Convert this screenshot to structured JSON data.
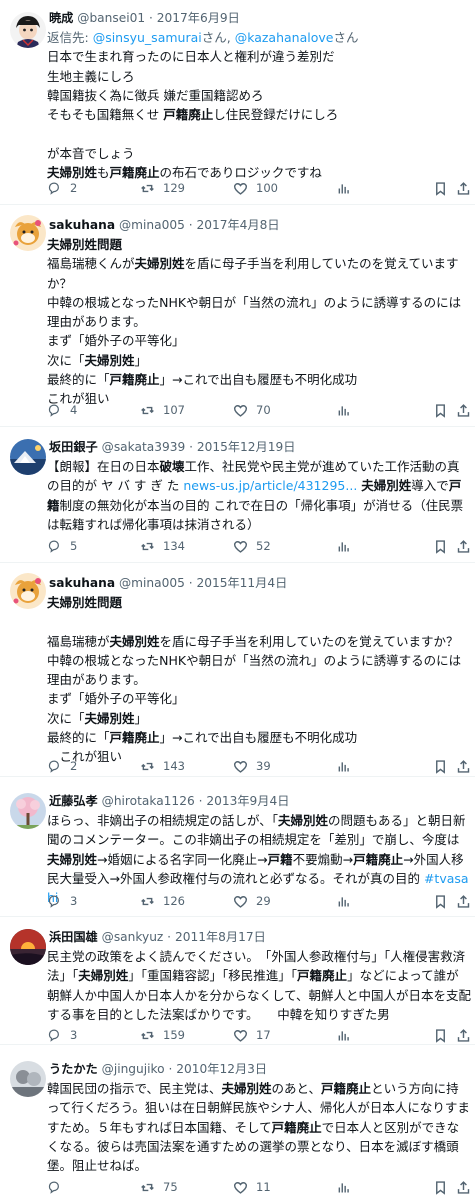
{
  "tweets": [
    {
      "name": "暁成",
      "handle": "@bansei01",
      "date": "2017年6月9日",
      "reply_prefix": "返信先: ",
      "reply_mention1": "@sinsyu_samurai",
      "reply_mid": "さん, ",
      "reply_mention2": "@kazahanalove",
      "reply_suffix": "さん",
      "lines": [
        "日本で生まれ育ったのに日本人と権利が違う差別だ",
        "生地主義にしろ",
        "韓国籍抜く為に徴兵 嫌だ重国籍認めろ",
        "そもそも国籍無くせ 戸籍廃止し住民登録だけにしろ",
        "",
        "が本音でしょう",
        "夫婦別姓も戸籍廃止の布石でありロジックですね"
      ],
      "counts": {
        "reply": "2",
        "retweet": "129",
        "like": "100"
      }
    },
    {
      "name": "sakuhana",
      "handle": "@mina005",
      "date": "2017年4月8日",
      "lines": [
        "夫婦別姓問題",
        "福島瑞穂くんが夫婦別姓を盾に母子手当を利用していたのを覚えていますか？",
        "中韓の根城となったNHKや朝日が「当然の流れ」のように誘導するのには理由があります。",
        "まず「婚外子の平等化」",
        "次に「夫婦別姓」",
        "最終的に「戸籍廃止」→これで出自も履歴も不明化成功",
        "これが狙い"
      ],
      "counts": {
        "reply": "4",
        "retweet": "107",
        "like": "70"
      }
    },
    {
      "name": "坂田銀子",
      "handle": "@sakata3939",
      "date": "2015年12月19日",
      "text": "【朗報】在日の日本破壊工作、社民党や民主党が進めていた工作活動の真の目的が ヤ バ す ぎ た news-us.jp/article/431295... 夫婦別姓導入で戸籍制度の無効化が本当の目的 これで在日の「帰化事項」が消せる（住民票は転籍すれば帰化事項は抹消される）",
      "link": "news-us.jp/article/431295...",
      "counts": {
        "reply": "5",
        "retweet": "134",
        "like": "52"
      }
    },
    {
      "name": "sakuhana",
      "handle": "@mina005",
      "date": "2015年11月4日",
      "lines": [
        "夫婦別姓問題",
        "",
        "福島瑞穂が夫婦別姓を盾に母子手当を利用していたのを覚えていますか？",
        "中韓の根城となったNHKや朝日が「当然の流れ」のように誘導するのには理由があります。",
        "まず「婚外子の平等化」",
        "次に「夫婦別姓」",
        "最終的に「戸籍廃止」→これで出自も履歴も不明化成功",
        "　これが狙い"
      ],
      "counts": {
        "reply": "2",
        "retweet": "143",
        "like": "39"
      }
    },
    {
      "name": "近藤弘孝",
      "handle": "@hirotaka1126",
      "date": "2013年9月4日",
      "text": "ほらっ、非嫡出子の相続規定の話しが、「夫婦別姓の問題もある」と朝日新聞のコメンテーター。この非嫡出子の相続規定を「差別」で崩し、今度は夫婦別姓→婚姻による名字同一化廃止→戸籍不要煽動→戸籍廃止→外国人移民大量受入→外国人参政権付与の流れと必ずなる。それが真の目的 #tvasahi",
      "hashtag": "#tvasahi",
      "counts": {
        "reply": "3",
        "retweet": "126",
        "like": "29"
      }
    },
    {
      "name": "浜田国雄",
      "handle": "@sankyuz",
      "date": "2011年8月17日",
      "text": "民主党の政策をよく読んでください。　「外国人参政権付与」「人権侵害救済法」「夫婦別姓」「重国籍容認」「移民推進」「戸籍廃止」などによって誰が朝鮮人か中国人か日本人かを分からなくして、朝鮮人と中国人が日本を支配する事を目的とした法案ばかりです。　　中韓を知りすぎた男",
      "counts": {
        "reply": "3",
        "retweet": "159",
        "like": "17"
      }
    },
    {
      "name": "うたかた",
      "handle": "@jingujiko",
      "date": "2010年12月3日",
      "text": "韓国民団の指示で、民主党は、夫婦別姓のあと、戸籍廃止という方向に持って行くだろう。狙いは在日朝鮮民族やシナ人、帰化人が日本人になりすますため。５年もすれば日本国籍、そして戸籍廃止で日本人と区別ができなくなる。彼らは売国法案を通すための選挙の票となり、日本を滅ぼす橋頭堡。阻止せねば。",
      "counts": {
        "reply": "",
        "retweet": "75",
        "like": "11"
      }
    }
  ],
  "ui": {
    "separator": " · ",
    "icons": [
      "reply-icon",
      "retweet-icon",
      "like-icon",
      "views-icon",
      "bookmark-icon",
      "share-icon"
    ],
    "link_color": "#1d9bf0",
    "muted_color": "#536471"
  }
}
